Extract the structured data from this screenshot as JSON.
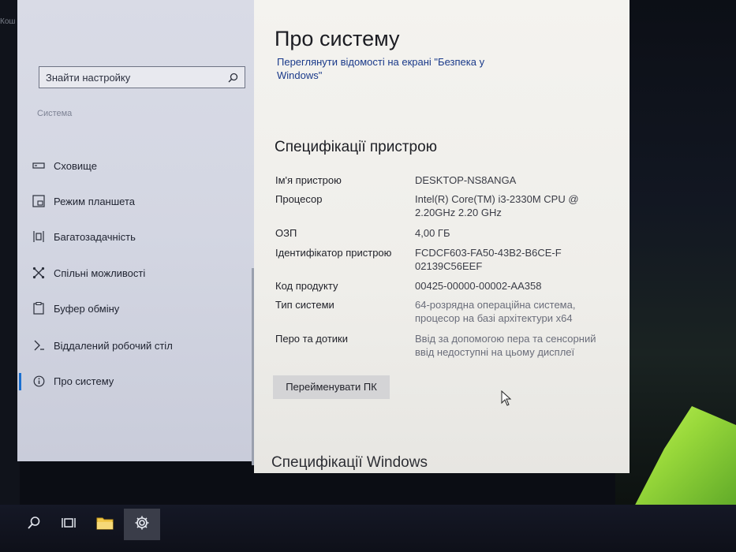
{
  "corner_text": "Кош",
  "sidebar": {
    "search_placeholder": "Знайти настройку",
    "section_label": "Система",
    "items": [
      {
        "label": "Сховище",
        "icon": "storage-icon"
      },
      {
        "label": "Режим планшета",
        "icon": "tablet-mode-icon"
      },
      {
        "label": "Багатозадачність",
        "icon": "multitasking-icon"
      },
      {
        "label": "Спільні можливості",
        "icon": "shared-experiences-icon"
      },
      {
        "label": "Буфер обміну",
        "icon": "clipboard-icon"
      },
      {
        "label": "Віддалений робочий стіл",
        "icon": "remote-desktop-icon"
      },
      {
        "label": "Про систему",
        "icon": "info-icon",
        "selected": true
      }
    ]
  },
  "content": {
    "title": "Про систему",
    "security_link": "Переглянути відомості на екрані \"Безпека у Windows\"",
    "device_spec_heading": "Специфікації пристрою",
    "specs": [
      {
        "key": "Ім'я пристрою",
        "value": "DESKTOP-NS8ANGA"
      },
      {
        "key": "Процесор",
        "value": "Intel(R) Core(TM) i3-2330M CPU @ 2.20GHz   2.20 GHz"
      },
      {
        "key": "ОЗП",
        "value": "4,00 ГБ"
      },
      {
        "key": "Ідентифікатор пристрою",
        "value": "FCDCF603-FA50-43B2-B6CE-F02139C56EEF"
      },
      {
        "key": "Код продукту",
        "value": "00425-00000-00002-AA358"
      },
      {
        "key": "Тип системи",
        "value": "64-розрядна операційна система, процесор на базі архітектури x64"
      },
      {
        "key": "Перо та дотики",
        "value": "Ввід за допомогою пера та сенсорний ввід недоступні на цьому дисплеї"
      }
    ],
    "rename_button": "Перейменувати ПК",
    "windows_spec_heading": "Специфікації Windows"
  },
  "taskbar": {
    "items": [
      {
        "icon": "search-icon"
      },
      {
        "icon": "task-view-icon"
      },
      {
        "icon": "file-explorer-icon"
      },
      {
        "icon": "settings-gear-icon",
        "active": true
      }
    ]
  }
}
